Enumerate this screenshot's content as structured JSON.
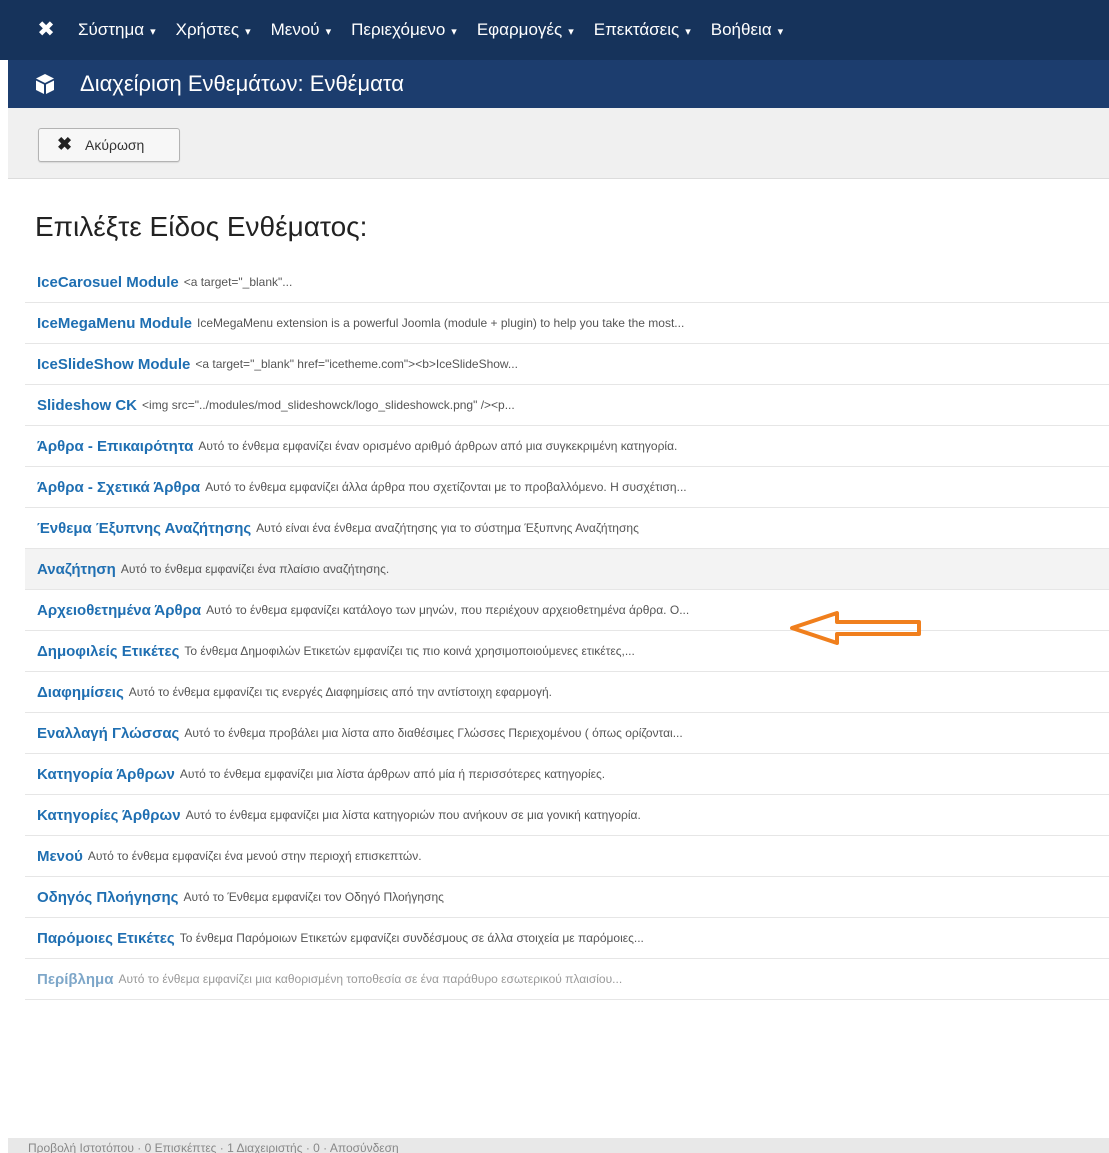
{
  "nav": {
    "logo_icon": "joomla-logo-icon",
    "menu": [
      {
        "label": "Σύστημα"
      },
      {
        "label": "Χρήστες"
      },
      {
        "label": "Μενού"
      },
      {
        "label": "Περιεχόμενο"
      },
      {
        "label": "Εφαρμογές"
      },
      {
        "label": "Επεκτάσεις"
      },
      {
        "label": "Βοήθεια"
      }
    ],
    "caret": "▾"
  },
  "titlebar": {
    "icon": "cube-icon",
    "title": "Διαχείριση Ενθεμάτων: Ενθέματα"
  },
  "toolbar": {
    "cancel_icon": "close-icon",
    "cancel_label": "Ακύρωση"
  },
  "heading": "Επιλέξτε Είδος Ενθέματος:",
  "modules": [
    {
      "name": "IceCarosuel Module",
      "desc": "<a target=\"_blank\"..."
    },
    {
      "name": "IceMegaMenu Module",
      "desc": "IceMegaMenu extension is a powerful Joomla (module + plugin) to help you take the most..."
    },
    {
      "name": "IceSlideShow Module",
      "desc": "<a target=\"_blank\" href=\"icetheme.com\"><b>IceSlideShow..."
    },
    {
      "name": "Slideshow CK",
      "desc": "<img src=\"../modules/mod_slideshowck/logo_slideshowck.png\" /><p..."
    },
    {
      "name": "Άρθρα - Επικαιρότητα",
      "desc": "Αυτό το ένθεμα εμφανίζει έναν ορισμένο αριθμό άρθρων από μια συγκεκριμένη κατηγορία."
    },
    {
      "name": "Άρθρα - Σχετικά Άρθρα",
      "desc": "Αυτό το ένθεμα εμφανίζει άλλα άρθρα που σχετίζονται με το προβαλλόμενο. Η συσχέτιση..."
    },
    {
      "name": "Ένθεμα Έξυπνης Αναζήτησης",
      "desc": "Αυτό είναι ένα ένθεμα αναζήτησης για το σύστημα Έξυπνης Αναζήτησης"
    },
    {
      "name": "Αναζήτηση",
      "desc": "Αυτό το ένθεμα εμφανίζει ένα πλαίσιο αναζήτησης."
    },
    {
      "name": "Αρχειοθετημένα Άρθρα",
      "desc": "Αυτό το ένθεμα εμφανίζει κατάλογο των μηνών, που περιέχουν αρχειοθετημένα άρθρα. Ο..."
    },
    {
      "name": "Δημοφιλείς Ετικέτες",
      "desc": "Το ένθεμα Δημοφιλών Ετικετών εμφανίζει τις πιο κοινά χρησιμοποιούμενες ετικέτες,..."
    },
    {
      "name": "Διαφημίσεις",
      "desc": "Αυτό το ένθεμα εμφανίζει τις ενεργές Διαφημίσεις από την αντίστοιχη εφαρμογή."
    },
    {
      "name": "Εναλλαγή Γλώσσας",
      "desc": "Αυτό το ένθεμα προβάλει μια λίστα απο διαθέσιμες Γλώσσες Περιεχομένου ( όπως ορίζονται..."
    },
    {
      "name": "Κατηγορία Άρθρων",
      "desc": "Αυτό το ένθεμα εμφανίζει μια λίστα άρθρων από μία ή περισσότερες κατηγορίες."
    },
    {
      "name": "Κατηγορίες Άρθρων",
      "desc": "Αυτό το ένθεμα εμφανίζει μια λίστα κατηγοριών που ανήκουν σε μια γονική κατηγορία."
    },
    {
      "name": "Μενού",
      "desc": "Αυτό το ένθεμα εμφανίζει ένα μενού στην περιοχή επισκεπτών."
    },
    {
      "name": "Οδηγός Πλοήγησης",
      "desc": "Αυτό το Ένθεμα εμφανίζει τον Οδηγό Πλοήγησης"
    },
    {
      "name": "Παρόμοιες Ετικέτες",
      "desc": "Το ένθεμα Παρόμοιων Ετικετών εμφανίζει συνδέσμους σε άλλα στοιχεία με παρόμοιες..."
    },
    {
      "name": "Περίβλημα",
      "desc": "Αυτό το ένθεμα εμφανίζει μια καθορισμένη τοποθεσία σε ένα παράθυρο εσωτερικού πλαισίου..."
    }
  ],
  "statusbar": {
    "text": "Προβολή Ιστοτόπου · 0 Επισκέπτες · 1 Διαχειριστής · 0 · Αποσύνδεση"
  },
  "colors": {
    "nav_bg": "#16335b",
    "title_bg": "#1c3d6e",
    "link": "#1f6fb2",
    "arrow": "#f07f1d"
  }
}
